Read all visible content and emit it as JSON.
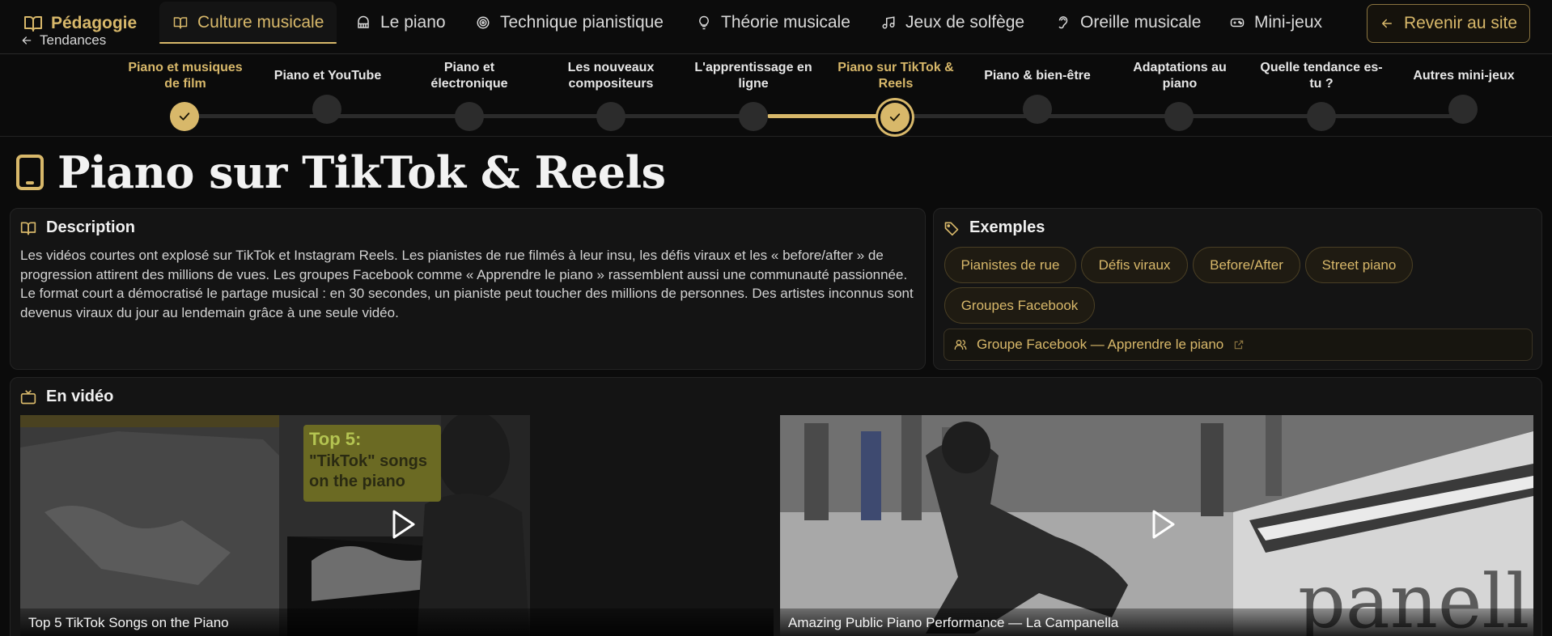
{
  "nav": {
    "brand": "Pédagogie",
    "items": [
      {
        "label": "Culture musicale",
        "icon": "book-icon",
        "active": true
      },
      {
        "label": "Le piano",
        "icon": "piano-icon"
      },
      {
        "label": "Technique pianistique",
        "icon": "target-icon"
      },
      {
        "label": "Théorie musicale",
        "icon": "lightbulb-icon"
      },
      {
        "label": "Jeux de solfège",
        "icon": "music-note-icon"
      },
      {
        "label": "Oreille musicale",
        "icon": "ear-icon"
      },
      {
        "label": "Mini-jeux",
        "icon": "gamepad-icon"
      }
    ],
    "back_label": "Revenir au site"
  },
  "stepper": {
    "back_label": "Tendances",
    "steps": [
      {
        "label": "Piano et musiques de film",
        "state": "done"
      },
      {
        "label": "Piano et YouTube",
        "state": "todo"
      },
      {
        "label": "Piano et électronique",
        "state": "todo"
      },
      {
        "label": "Les nouveaux compositeurs",
        "state": "todo"
      },
      {
        "label": "L'apprentissage en ligne",
        "state": "todo"
      },
      {
        "label": "Piano sur TikTok & Reels",
        "state": "current"
      },
      {
        "label": "Piano & bien-être",
        "state": "todo"
      },
      {
        "label": "Adaptations au piano",
        "state": "todo"
      },
      {
        "label": "Quelle tendance es-tu ?",
        "state": "todo"
      },
      {
        "label": "Autres mini-jeux",
        "state": "todo"
      }
    ]
  },
  "page": {
    "title": "Piano sur TikTok & Reels"
  },
  "description": {
    "heading": "Description",
    "text": "Les vidéos courtes ont explosé sur TikTok et Instagram Reels. Les pianistes de rue filmés à leur insu, les défis viraux et les « before/after » de progression attirent des millions de vues. Les groupes Facebook comme « Apprendre le piano » rassemblent aussi une communauté passionnée. Le format court a démocratisé le partage musical : en 30 secondes, un pianiste peut toucher des millions de personnes. Des artistes inconnus sont devenus viraux du jour au lendemain grâce à une seule vidéo."
  },
  "examples": {
    "heading": "Exemples",
    "chips": [
      "Pianistes de rue",
      "Défis viraux",
      "Before/After",
      "Street piano",
      "Groupes Facebook"
    ],
    "link_label": "Groupe Facebook — Apprendre le piano"
  },
  "videos": {
    "heading": "En vidéo",
    "items": [
      {
        "caption": "Top 5 TikTok Songs on the Piano",
        "overlay_line1": "Top 5:",
        "overlay_line2": "\"TikTok\" songs",
        "overlay_line3": "on the piano"
      },
      {
        "caption": "Amazing Public Piano Performance — La Campanella",
        "overlay_text": "panella"
      }
    ]
  },
  "colors": {
    "accent": "#d8b86a",
    "background": "#0b0b0b",
    "card": "#141414"
  }
}
